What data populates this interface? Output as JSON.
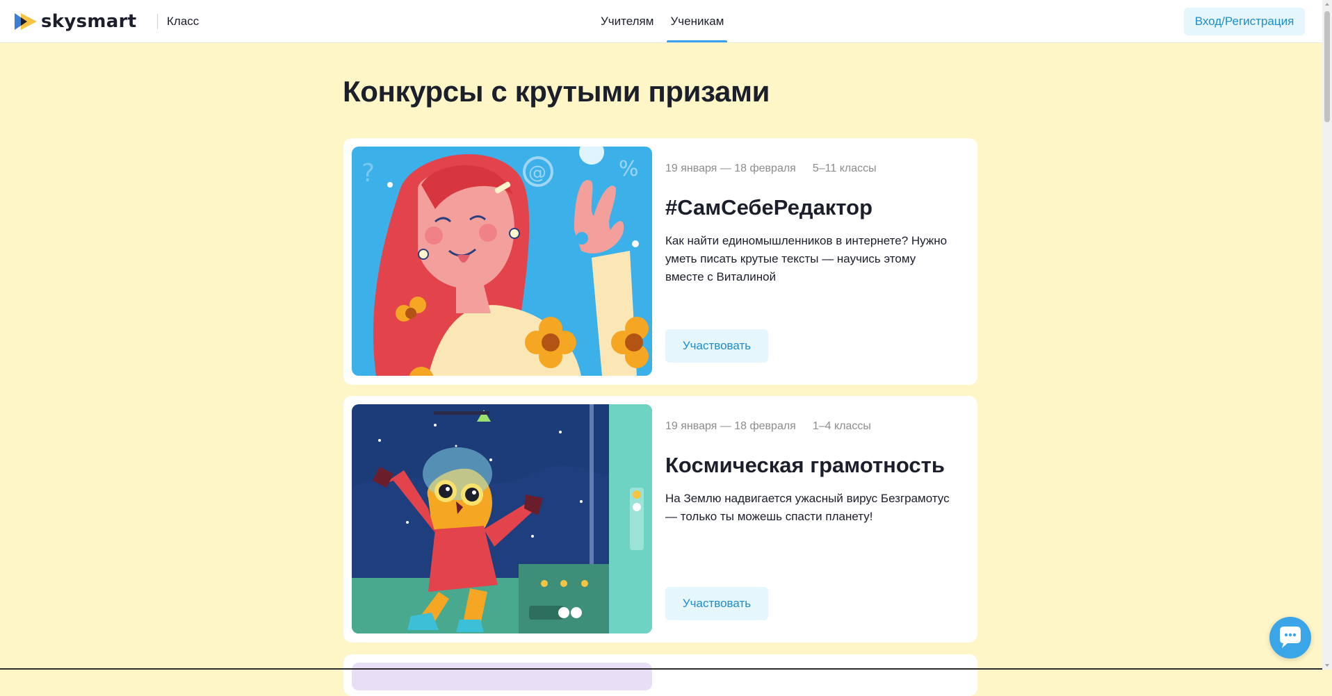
{
  "header": {
    "logo_text": "skysmart",
    "logo_subtitle": "Класс",
    "nav": [
      {
        "label": "Учителям",
        "active": false
      },
      {
        "label": "Ученикам",
        "active": true
      }
    ],
    "login_label": "Вход/Регистрация"
  },
  "page": {
    "title": "Конкурсы с крутыми призами"
  },
  "contests": [
    {
      "dates": "19 января — 18 февраля",
      "grades": "5–11 классы",
      "title": "#СамСебеРедактор",
      "description": "Как найти единомышленников в интернете? Нужно уметь писать крутые тексты — научись этому вместе с Виталиной",
      "button_label": "Участвовать",
      "image_icon": "girl-illustration"
    },
    {
      "dates": "19 января — 18 февраля",
      "grades": "1–4 классы",
      "title": "Космическая грамотность",
      "description": "На Землю надвигается ужасный вирус Безграмотус — только ты можешь спасти планету!",
      "button_label": "Участвовать",
      "image_icon": "space-owl-illustration"
    }
  ],
  "colors": {
    "page_background": "#fef6c7",
    "accent": "#1c8dcd",
    "button_background": "#e6f6fd",
    "nav_underline": "#38a0ec"
  },
  "icons": {
    "logo": "skysmart-play-logo-icon",
    "chat": "chat-bubble-icon"
  }
}
